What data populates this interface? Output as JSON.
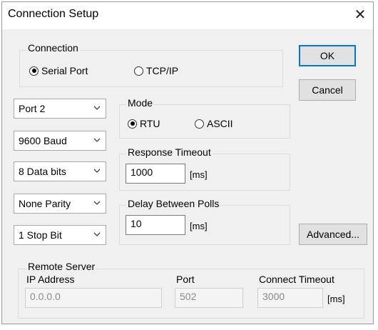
{
  "window": {
    "title": "Connection Setup"
  },
  "connection": {
    "label": "Connection",
    "serial_label": "Serial Port",
    "tcp_label": "TCP/IP",
    "selected": "Serial Port"
  },
  "buttons": {
    "ok": "OK",
    "cancel": "Cancel",
    "advanced": "Advanced..."
  },
  "serial": {
    "port": "Port 2",
    "baud": "9600 Baud",
    "data_bits": "8 Data bits",
    "parity": "None Parity",
    "stop_bits": "1 Stop Bit"
  },
  "mode": {
    "label": "Mode",
    "rtu": "RTU",
    "ascii": "ASCII",
    "selected": "RTU"
  },
  "response_timeout": {
    "label": "Response Timeout",
    "value": "1000",
    "unit": "[ms]"
  },
  "delay_between_polls": {
    "label": "Delay Between Polls",
    "value": "10",
    "unit": "[ms]"
  },
  "remote_server": {
    "label": "Remote Server",
    "ip_label": "IP Address",
    "ip_value": "0.0.0.0",
    "port_label": "Port",
    "port_value": "502",
    "connect_timeout_label": "Connect Timeout",
    "connect_timeout_value": "3000",
    "unit": "[ms]"
  }
}
